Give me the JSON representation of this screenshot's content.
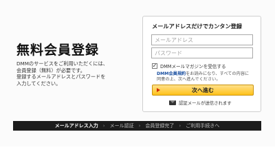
{
  "left": {
    "title": "無料会員登録",
    "desc_lines": [
      "DMMのサービスをご利用いただくには、",
      "会員登録（無料）が必要です。",
      "登録するメールアドレスとパスワードを",
      "入力してください。"
    ]
  },
  "card": {
    "title": "メールアドレスだけでカンタン登録",
    "email_placeholder": "メールアドレス",
    "password_placeholder": "パスワード",
    "newsletter_label": "DMMメールマガジンを受信する",
    "newsletter_checked_mark": "✓",
    "terms_link": "DMM会員規約",
    "terms_line1_rest": "をお読みになり、すべての内容に",
    "terms_line2": "同意の上、次へ進んでください。",
    "submit_label": "次へ進む",
    "mail_note": "認証メールが送信されます"
  },
  "steps": {
    "items": [
      "メールアドレス入力",
      "メール認証",
      "会員登録完了",
      "ご利用手続きへ"
    ],
    "separator": "›"
  },
  "icons": {
    "submit_arrow": "play-arrow-icon",
    "mail": "envelope-icon"
  },
  "colors": {
    "submit_top": "#ffe08a",
    "submit_bottom": "#ffc21a",
    "link": "#1a4fa0",
    "steps_bg": "#1c1c1c"
  }
}
